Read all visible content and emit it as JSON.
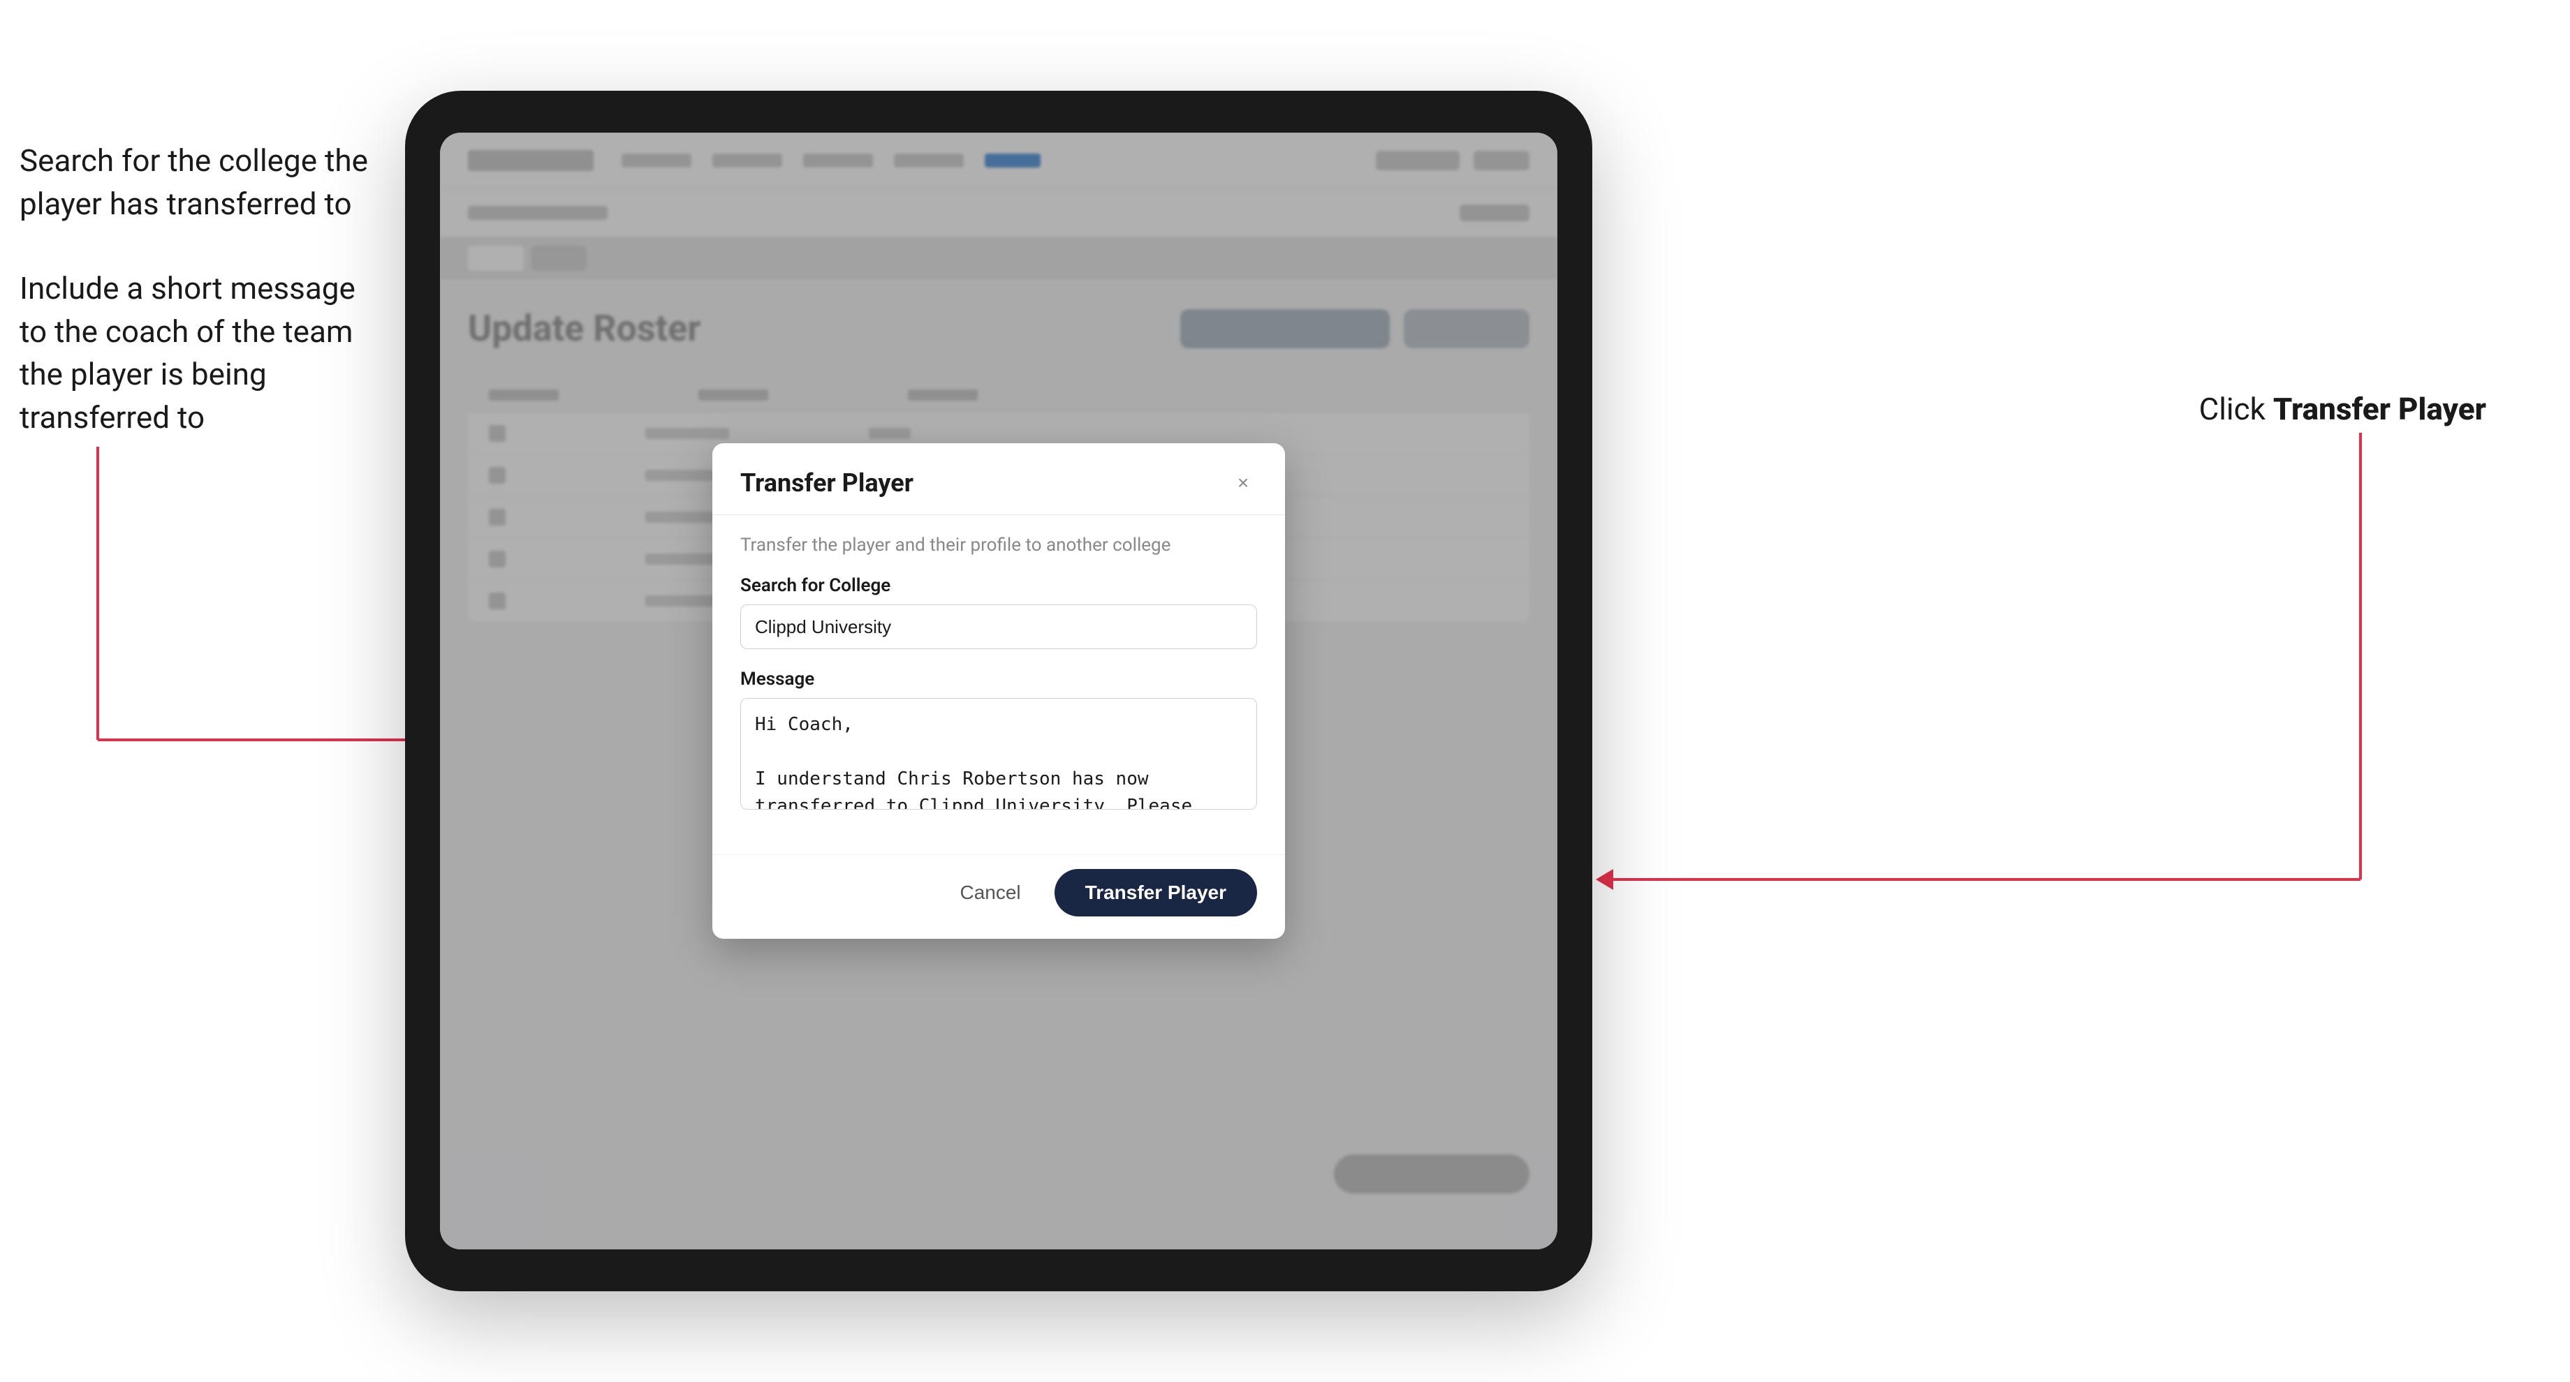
{
  "annotations": {
    "left_top": "Search for the college the player has transferred to",
    "left_bottom": "Include a short message to the coach of the team the player is being transferred to",
    "right": "Click ",
    "right_bold": "Transfer Player"
  },
  "modal": {
    "title": "Transfer Player",
    "description": "Transfer the player and their profile to another college",
    "search_label": "Search for College",
    "search_value": "Clippd University",
    "message_label": "Message",
    "message_value": "Hi Coach,\n\nI understand Chris Robertson has now transferred to Clippd University. Please accept this transfer request when you can.",
    "cancel_label": "Cancel",
    "transfer_label": "Transfer Player"
  },
  "app": {
    "page_title": "Update Roster"
  }
}
